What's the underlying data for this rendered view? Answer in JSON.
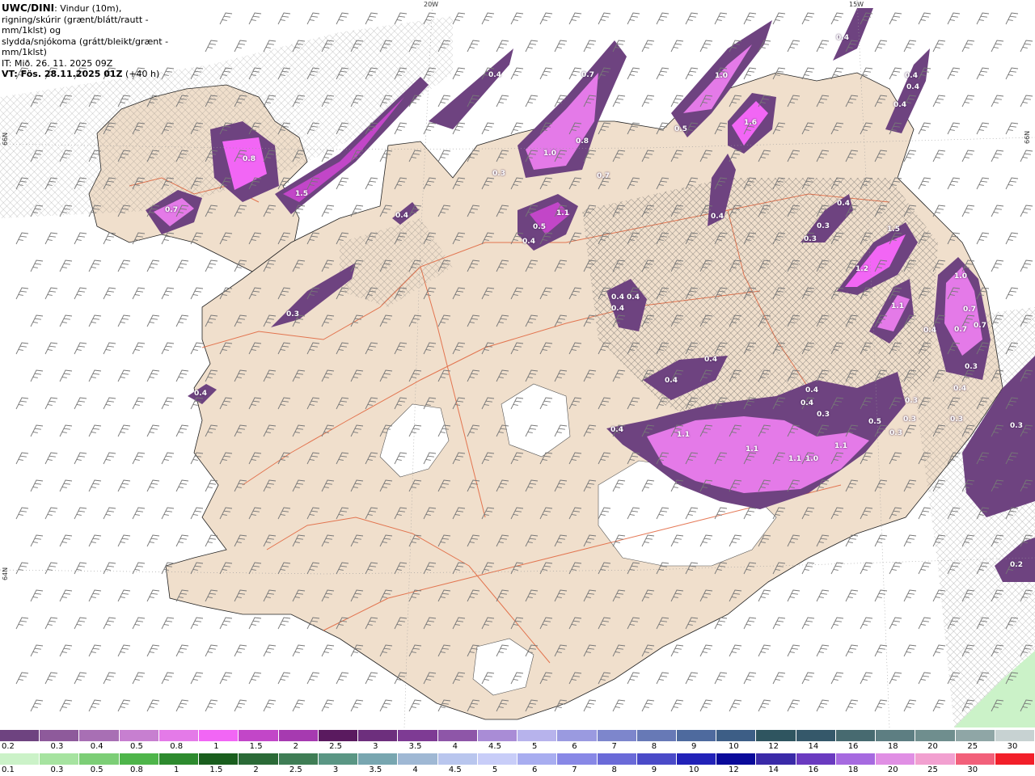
{
  "header": {
    "model": "UWC/DINI",
    "line1_rest": ": Vindur (10m),",
    "line2": "rigning/skúrir (grænt/blátt/rautt - mm/1klst) og",
    "line3": "slydda/snjókoma (grátt/bleikt/grænt - mm/1klst)",
    "line4": "IT: Mið. 26. 11. 2025 09Z",
    "line5_bold": "VT: Fös. 28.11.2025 01Z",
    "line5_rest": " (+40 h)"
  },
  "axis_labels": {
    "top_left": "20W",
    "top_right": "15W",
    "left_upper": "66N",
    "right_upper": "66N",
    "left_lower": "64N"
  },
  "colors": {
    "sea": "#ffffff",
    "land": "#f0dfcc",
    "ice": "#ffffff",
    "roads": "#e0623a",
    "hatch": "#555555",
    "precip_light": "#6e4380",
    "precip_mid": "#b04fbf",
    "precip_heavy": "#f266f5",
    "wind_barb": "#777777"
  },
  "precip_labels": [
    {
      "text": "0.4",
      "pos": "c1"
    },
    {
      "text": "0.7",
      "pos": "c2"
    },
    {
      "text": "1.0",
      "pos": "c3"
    },
    {
      "text": "0.4",
      "pos": "c4"
    },
    {
      "text": "0.4",
      "pos": "c5"
    },
    {
      "text": "0.4",
      "pos": "c6"
    },
    {
      "text": "0.4",
      "pos": "c7"
    },
    {
      "text": "0.8",
      "pos": "c8"
    },
    {
      "text": "1.5",
      "pos": "c9"
    },
    {
      "text": "0.7",
      "pos": "c10"
    },
    {
      "text": "0.3",
      "pos": "c11"
    },
    {
      "text": "1.0",
      "pos": "c12"
    },
    {
      "text": "0.8",
      "pos": "c13"
    },
    {
      "text": "0.7",
      "pos": "c14"
    },
    {
      "text": "0.5",
      "pos": "c15"
    },
    {
      "text": "1.1",
      "pos": "c16"
    },
    {
      "text": "0.4",
      "pos": "c17"
    },
    {
      "text": "0.5",
      "pos": "c18"
    },
    {
      "text": "1.6",
      "pos": "c19"
    },
    {
      "text": "0.4",
      "pos": "c20"
    },
    {
      "text": "0.3",
      "pos": "c21"
    },
    {
      "text": "0.3",
      "pos": "c22"
    },
    {
      "text": "0.4",
      "pos": "c23"
    },
    {
      "text": "1.5",
      "pos": "c24"
    },
    {
      "text": "1.2",
      "pos": "c25"
    },
    {
      "text": "1.1",
      "pos": "c26"
    },
    {
      "text": "1.0",
      "pos": "c27"
    },
    {
      "text": "0.7",
      "pos": "c28"
    },
    {
      "text": "0.7",
      "pos": "c29"
    },
    {
      "text": "0.7",
      "pos": "c30"
    },
    {
      "text": "0.3",
      "pos": "c31"
    },
    {
      "text": "0.4",
      "pos": "c32"
    },
    {
      "text": "0.4",
      "pos": "c33"
    },
    {
      "text": "0.4",
      "pos": "c34"
    },
    {
      "text": "0.4",
      "pos": "c35"
    },
    {
      "text": "0.4",
      "pos": "c36"
    },
    {
      "text": "0.4",
      "pos": "c37"
    },
    {
      "text": "0.4",
      "pos": "c38"
    },
    {
      "text": "0.5",
      "pos": "c39"
    },
    {
      "text": "0.3",
      "pos": "c40"
    },
    {
      "text": "0.3",
      "pos": "c41"
    },
    {
      "text": "1.1",
      "pos": "c42"
    },
    {
      "text": "1.1",
      "pos": "c43"
    },
    {
      "text": "1.1",
      "pos": "c44"
    },
    {
      "text": "1.0",
      "pos": "c45"
    },
    {
      "text": "1.1",
      "pos": "c46"
    },
    {
      "text": "0.4",
      "pos": "c47"
    },
    {
      "text": "0.4",
      "pos": "c48"
    },
    {
      "text": "0.3",
      "pos": "c49"
    },
    {
      "text": "0.3",
      "pos": "c50"
    },
    {
      "text": "0.2",
      "pos": "c51"
    },
    {
      "text": "0.3",
      "pos": "c52"
    },
    {
      "text": "0.4",
      "pos": "c53"
    },
    {
      "text": "0.3",
      "pos": "c54"
    },
    {
      "text": "0.4",
      "pos": "c55"
    },
    {
      "text": "0.4",
      "pos": "c56"
    },
    {
      "text": "0.3",
      "pos": "c57"
    }
  ],
  "legend": {
    "snow_row_colors": [
      "#6e4380",
      "#8e5a9b",
      "#a86fb4",
      "#c77fd0",
      "#e47ae8",
      "#f266f5",
      "#c246c8",
      "#a63ab0",
      "#5a1a5f",
      "#6d2f7d",
      "#7e3b94",
      "#8e56a8",
      "#a98cd6",
      "#b7b3ec",
      "#9a9ae0",
      "#7d86cc",
      "#6779b6",
      "#4e6a9e",
      "#3d5e86",
      "#2f5560",
      "#35586a",
      "#476a70",
      "#5d7e82",
      "#6f8e8e",
      "#8fa6a6",
      "#c7d2d2"
    ],
    "snow_row_ticks": [
      "0.2",
      "0.3",
      "0.4",
      "0.5",
      "0.8",
      "1",
      "1.5",
      "2",
      "2.5",
      "3",
      "3.5",
      "4",
      "4.5",
      "5",
      "6",
      "7",
      "8",
      "9",
      "10",
      "12",
      "14",
      "16",
      "18",
      "20",
      "25",
      "30"
    ],
    "rain_row_colors": [
      "#cbf2c8",
      "#a6e3a0",
      "#7cce76",
      "#4eb54a",
      "#2d8a2e",
      "#1a5e1e",
      "#2b6a37",
      "#3f7d55",
      "#5a9684",
      "#78a6b0",
      "#9fb8d4",
      "#b9c6ee",
      "#c8cdf8",
      "#a8adf0",
      "#8888e6",
      "#6a6ad8",
      "#4a4ac8",
      "#2222b8",
      "#0a0a9a",
      "#3a2aa8",
      "#6a3ac0",
      "#a66ae0",
      "#e08fe4",
      "#f2a0d0",
      "#f2607a",
      "#f21f2a"
    ],
    "rain_row_ticks": [
      "0.1",
      "0.3",
      "0.5",
      "0.8",
      "1",
      "1.5",
      "2",
      "2.5",
      "3",
      "3.5",
      "4",
      "4.5",
      "5",
      "6",
      "7",
      "8",
      "9",
      "10",
      "12",
      "14",
      "16",
      "18",
      "20",
      "25",
      "30"
    ]
  }
}
